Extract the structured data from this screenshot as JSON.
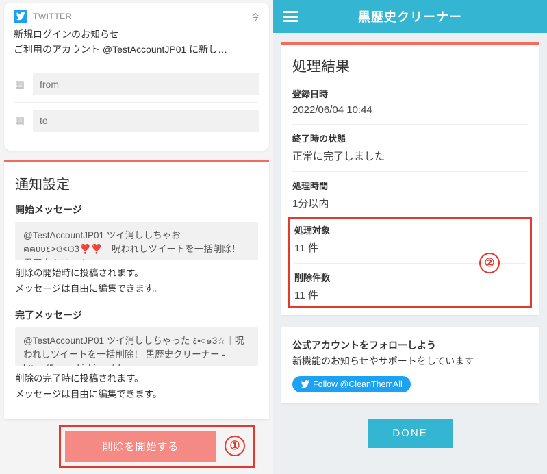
{
  "left": {
    "notification": {
      "app": "TWITTER",
      "time": "今",
      "title": "新規ログインのお知らせ",
      "body": "ご利用のアカウント @TestAccountJP01 に新し…",
      "from_placeholder": "from",
      "to_placeholder": "to"
    },
    "settings": {
      "heading": "通知設定",
      "start_label": "開始メッセージ",
      "start_msg": "@TestAccountJP01 ツイ消ししちゃお ฅฅʋʋ٤>ଓ<ଓ3❣️❣️｜呪われしツイートを一括削除！ 黒歴史クリーナー -",
      "start_help": "削除の開始時に投稿されます。\nメッセージは自由に編集できます。",
      "done_label": "完了メッセージ",
      "done_msg": "@TestAccountJP01 ツイ消ししちゃった ٤•○๑3☆｜呪われしツイートを一括削除！ 黒歴史クリーナー - https://kurorekishi.me/cleaner",
      "done_help": "削除の完了時に投稿されます。\nメッセージは自由に編集できます。",
      "start_button": "削除を開始する"
    },
    "callout1": "①"
  },
  "right": {
    "header_title": "黒歴史クリーナー",
    "result": {
      "heading": "処理結果",
      "rows": {
        "reg_label": "登録日時",
        "reg_value": "2022/06/04 10:44",
        "end_label": "終了時の状態",
        "end_value": "正常に完了しました",
        "dur_label": "処理時間",
        "dur_value": "1分以内",
        "target_label": "処理対象",
        "target_value": "11 件",
        "deleted_label": "削除件数",
        "deleted_value": "11 件"
      }
    },
    "callout2": "②",
    "follow": {
      "line1": "公式アカウントをフォローしよう",
      "line2": "新機能のお知らせやサポートをしています",
      "button": "Follow @CleanThemAll"
    },
    "done_button": "DONE"
  }
}
